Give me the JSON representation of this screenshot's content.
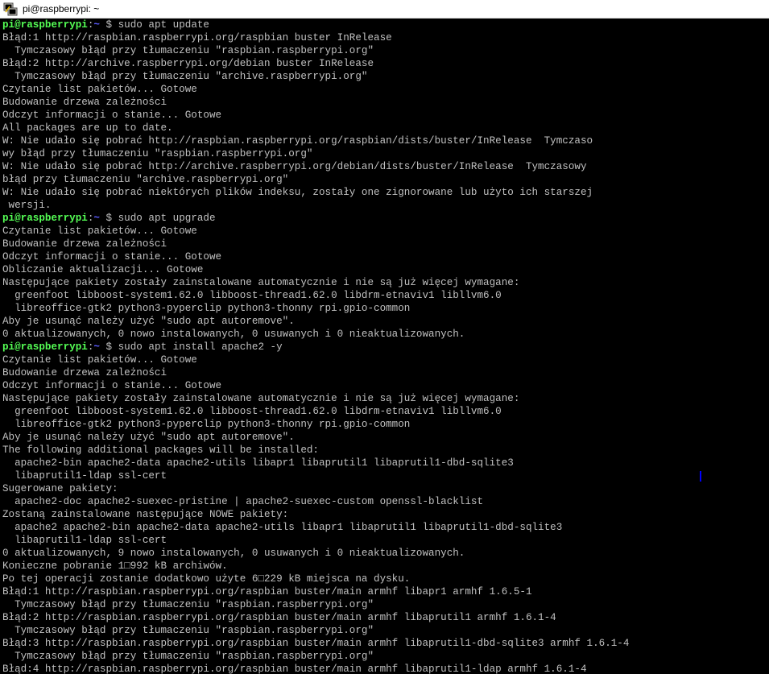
{
  "window": {
    "title": "pi@raspberrypi: ~",
    "icon": "putty-terminal-icon"
  },
  "colors": {
    "background": "#000000",
    "text": "#c0c0c0",
    "prompt_user": "#55ff55",
    "prompt_path": "#5c5cff"
  },
  "terminal": {
    "lines": [
      {
        "type": "prompt",
        "user": "pi@raspberrypi",
        "sep": ":",
        "path": "~",
        "sym": " $ ",
        "cmd": "sudo apt update"
      },
      {
        "type": "output",
        "text": "Błąd:1 http://raspbian.raspberrypi.org/raspbian buster InRelease"
      },
      {
        "type": "output",
        "text": "  Tymczasowy błąd przy tłumaczeniu \"raspbian.raspberrypi.org\""
      },
      {
        "type": "output",
        "text": "Błąd:2 http://archive.raspberrypi.org/debian buster InRelease"
      },
      {
        "type": "output",
        "text": "  Tymczasowy błąd przy tłumaczeniu \"archive.raspberrypi.org\""
      },
      {
        "type": "output",
        "text": "Czytanie list pakietów... Gotowe"
      },
      {
        "type": "output",
        "text": "Budowanie drzewa zależności"
      },
      {
        "type": "output",
        "text": "Odczyt informacji o stanie... Gotowe"
      },
      {
        "type": "output",
        "text": "All packages are up to date."
      },
      {
        "type": "output",
        "text": "W: Nie udało się pobrać http://raspbian.raspberrypi.org/raspbian/dists/buster/InRelease  Tymczaso"
      },
      {
        "type": "output",
        "text": "wy błąd przy tłumaczeniu \"raspbian.raspberrypi.org\""
      },
      {
        "type": "output",
        "text": "W: Nie udało się pobrać http://archive.raspberrypi.org/debian/dists/buster/InRelease  Tymczasowy"
      },
      {
        "type": "output",
        "text": "błąd przy tłumaczeniu \"archive.raspberrypi.org\""
      },
      {
        "type": "output",
        "text": "W: Nie udało się pobrać niektórych plików indeksu, zostały one zignorowane lub użyto ich starszej"
      },
      {
        "type": "output",
        "text": " wersji."
      },
      {
        "type": "prompt",
        "user": "pi@raspberrypi",
        "sep": ":",
        "path": "~",
        "sym": " $ ",
        "cmd": "sudo apt upgrade"
      },
      {
        "type": "output",
        "text": "Czytanie list pakietów... Gotowe"
      },
      {
        "type": "output",
        "text": "Budowanie drzewa zależności"
      },
      {
        "type": "output",
        "text": "Odczyt informacji o stanie... Gotowe"
      },
      {
        "type": "output",
        "text": "Obliczanie aktualizacji... Gotowe"
      },
      {
        "type": "output",
        "text": "Następujące pakiety zostały zainstalowane automatycznie i nie są już więcej wymagane:"
      },
      {
        "type": "output",
        "text": "  greenfoot libboost-system1.62.0 libboost-thread1.62.0 libdrm-etnaviv1 libllvm6.0"
      },
      {
        "type": "output",
        "text": "  libreoffice-gtk2 python3-pyperclip python3-thonny rpi.gpio-common"
      },
      {
        "type": "output",
        "text": "Aby je usunąć należy użyć \"sudo apt autoremove\"."
      },
      {
        "type": "output",
        "text": "0 aktualizowanych, 0 nowo instalowanych, 0 usuwanych i 0 nieaktualizowanych."
      },
      {
        "type": "prompt",
        "user": "pi@raspberrypi",
        "sep": ":",
        "path": "~",
        "sym": " $ ",
        "cmd": "sudo apt install apache2 -y"
      },
      {
        "type": "output",
        "text": "Czytanie list pakietów... Gotowe"
      },
      {
        "type": "output",
        "text": "Budowanie drzewa zależności"
      },
      {
        "type": "output",
        "text": "Odczyt informacji o stanie... Gotowe"
      },
      {
        "type": "output",
        "text": "Następujące pakiety zostały zainstalowane automatycznie i nie są już więcej wymagane:"
      },
      {
        "type": "output",
        "text": "  greenfoot libboost-system1.62.0 libboost-thread1.62.0 libdrm-etnaviv1 libllvm6.0"
      },
      {
        "type": "output",
        "text": "  libreoffice-gtk2 python3-pyperclip python3-thonny rpi.gpio-common"
      },
      {
        "type": "output",
        "text": "Aby je usunąć należy użyć \"sudo apt autoremove\"."
      },
      {
        "type": "output",
        "text": "The following additional packages will be installed:"
      },
      {
        "type": "output",
        "text": "  apache2-bin apache2-data apache2-utils libapr1 libaprutil1 libaprutil1-dbd-sqlite3"
      },
      {
        "type": "output",
        "text": "  libaprutil1-ldap ssl-cert"
      },
      {
        "type": "output",
        "text": "Sugerowane pakiety:"
      },
      {
        "type": "output",
        "text": "  apache2-doc apache2-suexec-pristine | apache2-suexec-custom openssl-blacklist"
      },
      {
        "type": "output",
        "text": "Zostaną zainstalowane następujące NOWE pakiety:"
      },
      {
        "type": "output",
        "text": "  apache2 apache2-bin apache2-data apache2-utils libapr1 libaprutil1 libaprutil1-dbd-sqlite3"
      },
      {
        "type": "output",
        "text": "  libaprutil1-ldap ssl-cert"
      },
      {
        "type": "output",
        "text": "0 aktualizowanych, 9 nowo instalowanych, 0 usuwanych i 0 nieaktualizowanych."
      },
      {
        "type": "output",
        "text": "Konieczne pobranie 1□992 kB archiwów."
      },
      {
        "type": "output",
        "text": "Po tej operacji zostanie dodatkowo użyte 6□229 kB miejsca na dysku."
      },
      {
        "type": "output",
        "text": "Błąd:1 http://raspbian.raspberrypi.org/raspbian buster/main armhf libapr1 armhf 1.6.5-1"
      },
      {
        "type": "output",
        "text": "  Tymczasowy błąd przy tłumaczeniu \"raspbian.raspberrypi.org\""
      },
      {
        "type": "output",
        "text": "Błąd:2 http://raspbian.raspberrypi.org/raspbian buster/main armhf libaprutil1 armhf 1.6.1-4"
      },
      {
        "type": "output",
        "text": "  Tymczasowy błąd przy tłumaczeniu \"raspbian.raspberrypi.org\""
      },
      {
        "type": "output",
        "text": "Błąd:3 http://raspbian.raspberrypi.org/raspbian buster/main armhf libaprutil1-dbd-sqlite3 armhf 1.6.1-4"
      },
      {
        "type": "output",
        "text": "  Tymczasowy błąd przy tłumaczeniu \"raspbian.raspberrypi.org\""
      },
      {
        "type": "output",
        "text": "Błąd:4 http://raspbian.raspberrypi.org/raspbian buster/main armhf libaprutil1-ldap armhf 1.6.1-4"
      }
    ]
  }
}
